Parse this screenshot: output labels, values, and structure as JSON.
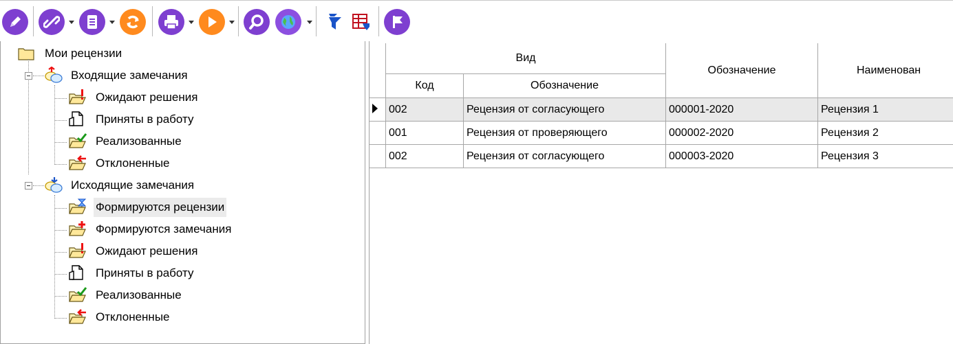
{
  "toolbar": {
    "buttons": [
      {
        "name": "edit-button",
        "icon": "pencil-icon"
      },
      {
        "name": "link-button",
        "icon": "link-icon"
      },
      {
        "name": "document-button",
        "icon": "document-icon"
      },
      {
        "name": "refresh-button",
        "icon": "refresh-icon"
      },
      {
        "name": "print-button",
        "icon": "printer-icon"
      },
      {
        "name": "run-button",
        "icon": "play-icon"
      },
      {
        "name": "search-button",
        "icon": "magnifier-icon"
      },
      {
        "name": "globe-button",
        "icon": "globe-icon"
      },
      {
        "name": "filter-button",
        "icon": "filter-icon"
      },
      {
        "name": "report-button",
        "icon": "table-report-icon"
      },
      {
        "name": "flag-button",
        "icon": "flag-icon"
      }
    ],
    "colors": {
      "purple": "#7e3fd0",
      "orange": "#ff8a1e",
      "blue": "#1a54c8"
    }
  },
  "tree": {
    "root": "Мои рецензии",
    "incoming": {
      "label": "Входящие замечания",
      "items": [
        "Ожидают решения",
        "Приняты в работу",
        "Реализованные",
        "Отклоненные"
      ]
    },
    "outgoing": {
      "label": "Исходящие замечания",
      "items": [
        "Формируются рецензии",
        "Формируются замечания",
        "Ожидают решения",
        "Приняты в работу",
        "Реализованные",
        "Отклоненные"
      ],
      "selected_index": 0
    }
  },
  "grid": {
    "group_header": "Вид",
    "columns": {
      "code": "Код",
      "kind_designation": "Обозначение",
      "designation": "Обозначение",
      "name": "Наименован"
    },
    "rows": [
      {
        "code": "002",
        "kind": "Рецензия от согласующего",
        "designation": "000001-2020",
        "name": "Рецензия 1"
      },
      {
        "code": "001",
        "kind": "Рецензия от проверяющего",
        "designation": "000002-2020",
        "name": "Рецензия 2"
      },
      {
        "code": "002",
        "kind": "Рецензия от согласующего",
        "designation": "000003-2020",
        "name": "Рецензия 3"
      }
    ],
    "current_row": 0
  }
}
